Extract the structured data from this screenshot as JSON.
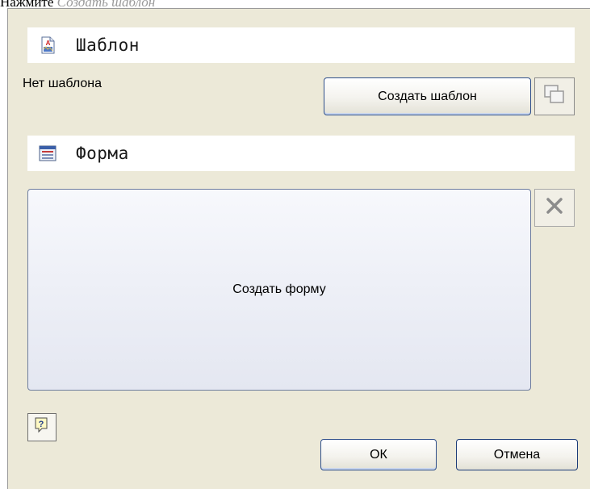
{
  "caption": {
    "prefix": "Нажмите",
    "emphasis": "Создать шаблон"
  },
  "template_section": {
    "title": "Шаблон",
    "icon": "template-document-icon",
    "status": "Нет шаблона",
    "create_button": "Создать шаблон",
    "copy_icon": "copy-icon"
  },
  "form_section": {
    "title": "Форма",
    "icon": "form-icon",
    "create_form": "Создать форму",
    "delete_icon": "close-icon"
  },
  "footer": {
    "help_icon": "help-icon",
    "ok_label": "ОК",
    "cancel_label": "Отмена"
  }
}
